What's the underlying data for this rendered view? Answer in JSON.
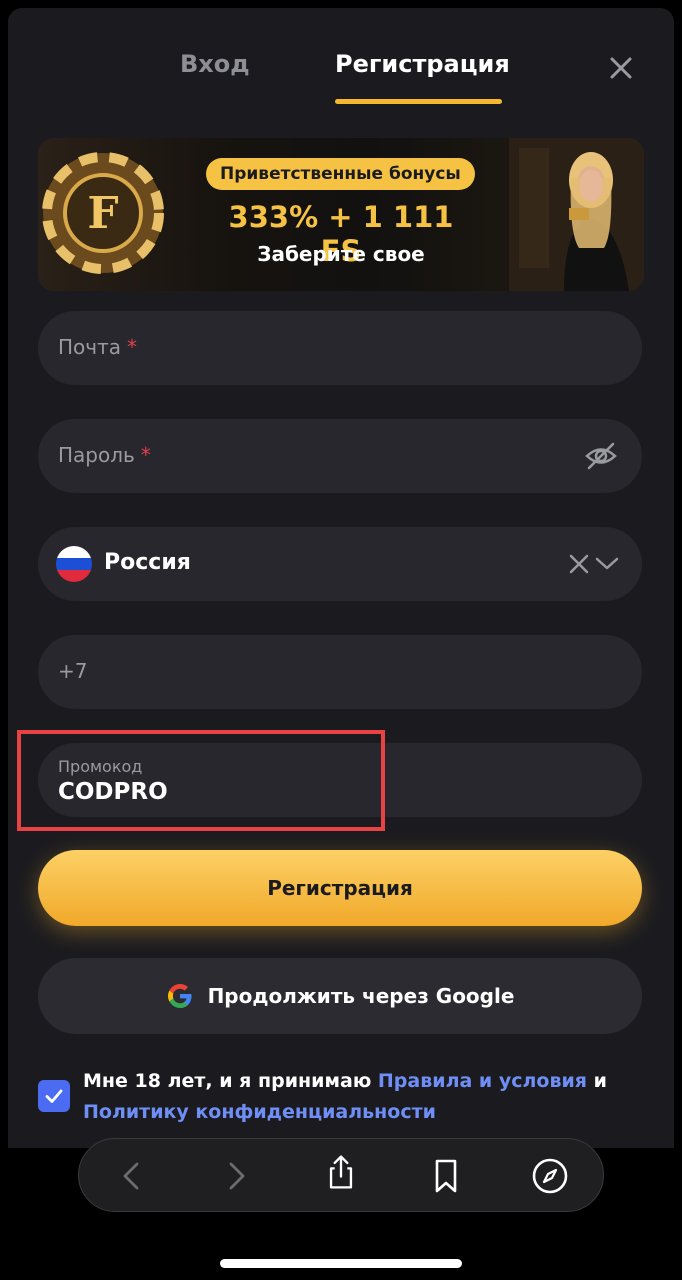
{
  "tabs": {
    "login": "Вход",
    "register": "Регистрация"
  },
  "banner": {
    "pill": "Приветственные бонусы",
    "amount": "333% + 1 111 FS",
    "cta": "Заберите свое"
  },
  "form": {
    "email_label": "Почта",
    "password_label": "Пароль",
    "required_mark": "*",
    "country_value": "Россия",
    "phone_prefix": "+7",
    "promo_label": "Промокод",
    "promo_value": "CODPRO"
  },
  "buttons": {
    "register": "Регистрация",
    "google": "Продолжить через Google"
  },
  "consent": {
    "text_before": "Мне 18 лет, и я принимаю ",
    "terms_link": "Правила и условия",
    "text_and": " и ",
    "privacy_link": "Политику конфиденциальности"
  },
  "colors": {
    "accent": "#f5b82e",
    "link": "#6f8ff7",
    "checkbox": "#4b6cf2",
    "highlight": "#e94245",
    "background": "#1b1b1f"
  },
  "icons": {
    "close": "close-icon",
    "eye_off": "eye-off-icon",
    "flag": "russia-flag-icon",
    "clear": "clear-icon",
    "chevron": "chevron-down-icon",
    "google": "google-icon",
    "checkbox": "checkmark-icon",
    "back": "chevron-left-icon",
    "forward": "chevron-right-icon",
    "share": "share-icon",
    "bookmark": "bookmark-icon",
    "compass": "compass-icon"
  }
}
